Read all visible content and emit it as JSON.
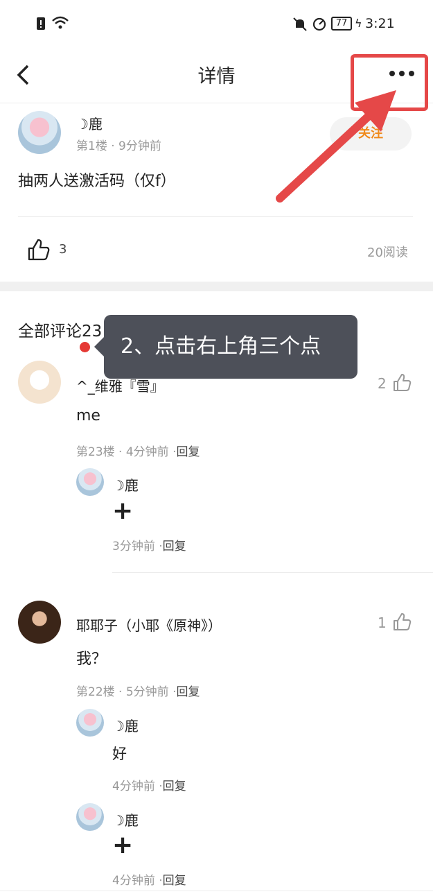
{
  "status_bar": {
    "time": "3:21",
    "battery": "77"
  },
  "header": {
    "title": "详情"
  },
  "post": {
    "author": "☽鹿",
    "meta": "第1楼 · 9分钟前",
    "follow_label": "关注",
    "content": "抽两人送激活码（仅f）",
    "like_count": "3",
    "read_count": "20阅读"
  },
  "comments_header": "全部评论23",
  "tooltip": {
    "text": "2、点击右上角三个点"
  },
  "comments": [
    {
      "author": "^_维雅『雪』",
      "likes": "2",
      "content": "me",
      "meta": "第23楼 · 4分钟前 ·",
      "reply_label": "回复",
      "replies": [
        {
          "author": "☽鹿",
          "content": "+",
          "meta": "3分钟前 ·",
          "reply_label": "回复"
        }
      ]
    },
    {
      "author": "耶耶子（小耶《原神》）",
      "likes": "1",
      "content": "我？",
      "meta": "第22楼 · 5分钟前 ·",
      "reply_label": "回复",
      "replies": [
        {
          "author": "☽鹿",
          "content": "好",
          "meta": "4分钟前 ·",
          "reply_label": "回复"
        },
        {
          "author": "☽鹿",
          "content": "+",
          "meta": "4分钟前 ·",
          "reply_label": "回复"
        }
      ]
    }
  ],
  "colors": {
    "accent": "#f08a1a",
    "highlight": "#e54848",
    "tooltip_bg": "#4d5059"
  },
  "icons": [
    "back-icon",
    "more-icon",
    "thumbs-up-icon",
    "wifi-icon",
    "sim-icon",
    "mute-icon",
    "battery-icon"
  ]
}
